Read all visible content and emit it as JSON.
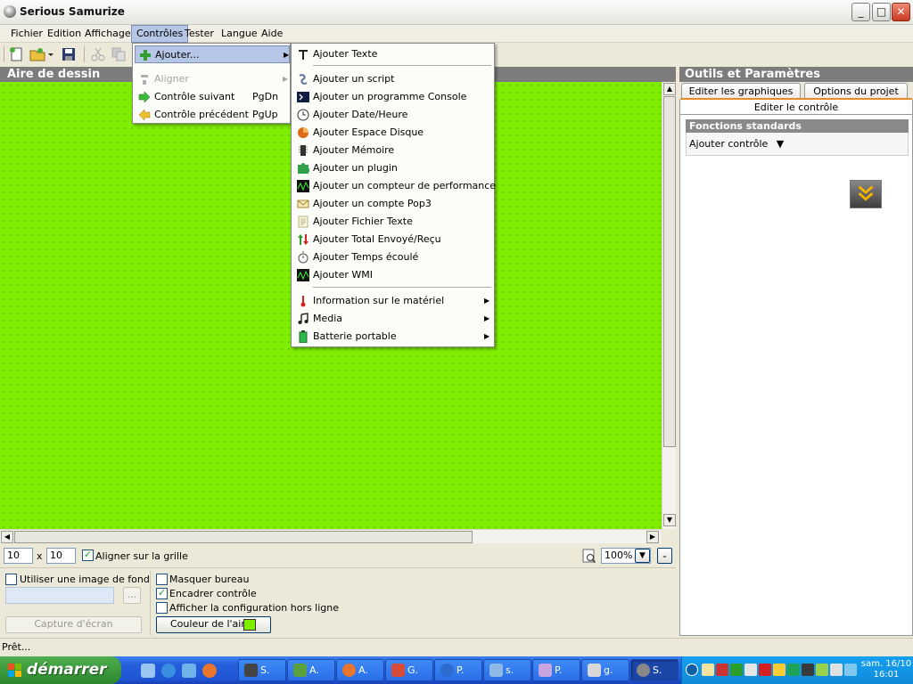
{
  "window": {
    "title": "Serious Samurize",
    "min": "_",
    "max": "□",
    "close": "✕"
  },
  "menubar": [
    "Fichier",
    "Edition",
    "Affichage",
    "Contrôles",
    "Tester",
    "Langue",
    "Aide"
  ],
  "controles_menu": {
    "items": [
      {
        "label": "Ajouter...",
        "icon": "plus-icon",
        "submenu": true,
        "highlight": true
      },
      {
        "label": "Aligner",
        "icon": "align-icon",
        "submenu": true,
        "disabled": true
      },
      {
        "label": "Contrôle suivant",
        "shortcut": "PgDn",
        "icon": "arrow-right-icon"
      },
      {
        "label": "Contrôle précédent",
        "shortcut": "PgUp",
        "icon": "arrow-left-icon"
      }
    ]
  },
  "ajouter_menu": {
    "items": [
      {
        "label": "Ajouter Texte",
        "icon": "text-icon"
      },
      {
        "label": "Ajouter un script",
        "icon": "script-icon"
      },
      {
        "label": "Ajouter un programme Console",
        "icon": "console-icon"
      },
      {
        "label": "Ajouter Date/Heure",
        "icon": "clock-icon"
      },
      {
        "label": "Ajouter Espace Disque",
        "icon": "pie-icon"
      },
      {
        "label": "Ajouter Mémoire",
        "icon": "memory-icon"
      },
      {
        "label": "Ajouter un plugin",
        "icon": "puzzle-icon"
      },
      {
        "label": "Ajouter un compteur de performance",
        "icon": "graph-icon"
      },
      {
        "label": "Ajouter un compte Pop3",
        "icon": "envelope-icon"
      },
      {
        "label": "Ajouter Fichier Texte",
        "icon": "file-icon"
      },
      {
        "label": "Ajouter Total Envoyé/Reçu",
        "icon": "updown-icon"
      },
      {
        "label": "Ajouter Temps écoulé",
        "icon": "stopwatch-icon"
      },
      {
        "label": "Ajouter WMI",
        "icon": "graph-icon"
      },
      {
        "label": "Information sur le matériel",
        "icon": "thermometer-icon",
        "submenu": true
      },
      {
        "label": "Media",
        "icon": "music-icon",
        "submenu": true
      },
      {
        "label": "Batterie portable",
        "icon": "battery-icon",
        "submenu": true
      }
    ]
  },
  "drawing": {
    "header": "Aire de dessin"
  },
  "grid": {
    "x": "10",
    "sep": "x",
    "y": "10",
    "align_label": "Aligner sur la grille",
    "align_checked": true,
    "zoom": "100%"
  },
  "bottom": {
    "bg_image_label": "Utiliser une image de fond",
    "browse": "...",
    "capture": "Capture d'écran",
    "masquer": "Masquer bureau",
    "encadrer": "Encadrer contrôle",
    "afficher": "Afficher la configuration hors ligne",
    "couleur": "Couleur de l'aire",
    "area_color": "#7fee00"
  },
  "right": {
    "header": "Outils et Paramètres",
    "tabs": [
      "Editer les graphiques",
      "Options du projet",
      "Editer le contrôle"
    ],
    "section": "Fonctions standards",
    "add_control": "Ajouter contrôle",
    "dropdown": "▼"
  },
  "status": "Prêt...",
  "taskbar": {
    "start": "démarrer",
    "tasks": [
      "S.",
      "A.",
      "A.",
      "G.",
      "P.",
      "s.",
      "P.",
      "g.",
      "S."
    ],
    "clock_day": "sam. 16/10",
    "clock_time": "16:01"
  },
  "colors": {
    "menu_highlight": "#b5c6e6",
    "panel_header": "#7c7c7c",
    "canvas": "#7fee00"
  }
}
